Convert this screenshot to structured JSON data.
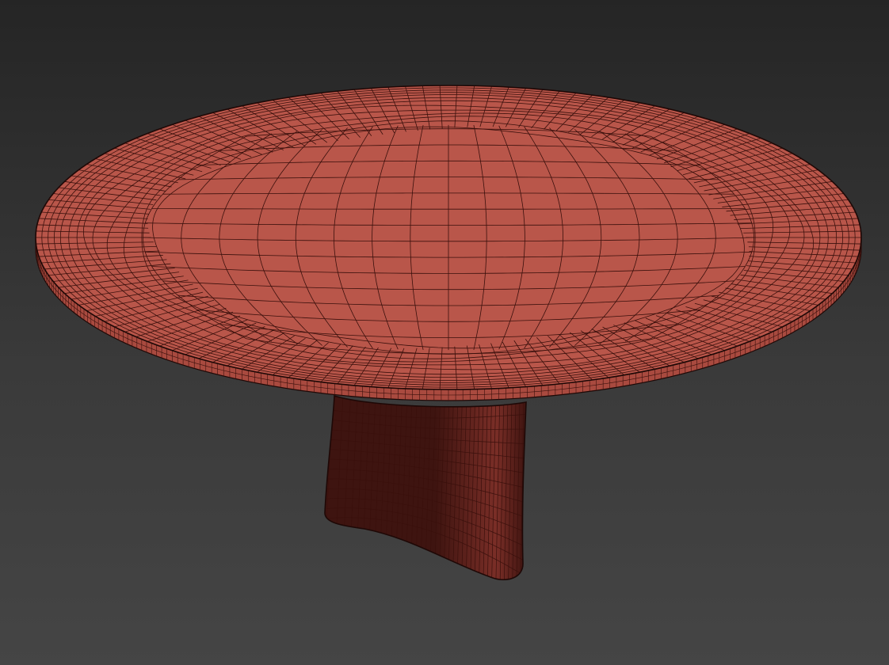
{
  "scene": {
    "subject": "round-table-wireframe",
    "render_mode": "shaded-with-wireframe-edges",
    "colors": {
      "background_top": "#252525",
      "background_bottom": "#454545",
      "tabletop_fill": "#b9564a",
      "tabletop_edge_fill": "#a94a3f",
      "base_fill_light": "#7a2e27",
      "base_fill_dark": "#3e1410",
      "wire_color": "#3a100c",
      "outline_color": "#1e0806"
    }
  }
}
